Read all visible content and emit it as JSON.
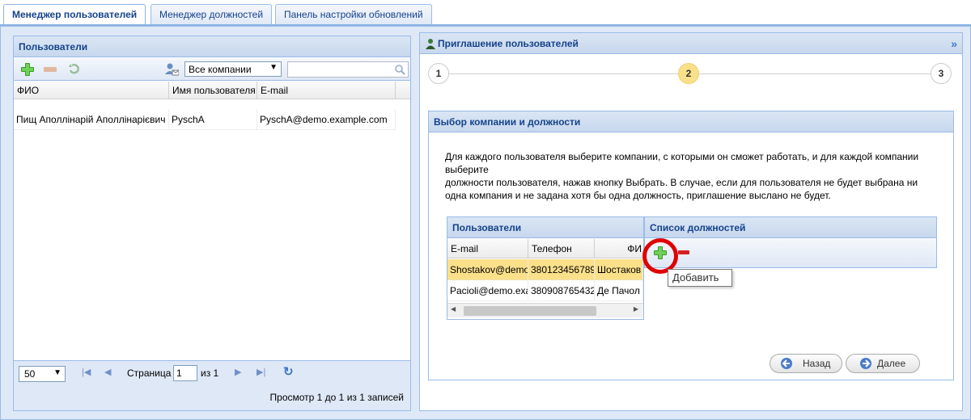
{
  "tabs": [
    {
      "label": "Менеджер пользователей"
    },
    {
      "label": "Менеджер должностей"
    },
    {
      "label": "Панель настройки обновлений"
    }
  ],
  "users_panel": {
    "title": "Пользователи",
    "company_filter": "Все компании",
    "search_placeholder": "",
    "columns": [
      "ФИО",
      "Имя пользователя",
      "E-mail"
    ],
    "rows": [
      {
        "name": "Пищ Аполлінарій Аполлінарієвич",
        "username": "PyschA",
        "email": "PyschA@demo.example.com"
      }
    ],
    "pager": {
      "page_size": "50",
      "page_label": "Страница",
      "page_value": "1",
      "of_label": "из 1",
      "summary": "Просмотр 1 до 1 из 1 записей"
    }
  },
  "invite_panel": {
    "title": "Приглашение пользователей",
    "steps": [
      "1",
      "2",
      "3"
    ],
    "section_title": "Выбор компании и должности",
    "description_lines": [
      "Для каждого пользователя выберите компании, с которыми он сможет работать, и для каждой компании",
      "выберите",
      "должности пользователя, нажав кнопку Выбрать. В случае, если для пользователя не будет выбрана ни",
      "одна компания и не задана хотя бы одна должность, приглашение выслано не будет."
    ],
    "sub_users": {
      "title": "Пользователи",
      "columns": [
        "E-mail",
        "Телефон",
        "ФИ"
      ],
      "rows": [
        {
          "email": "Shostakov@demo",
          "phone": "380123456789",
          "fio": "Шостаков"
        },
        {
          "email": "Pacioli@demo.exa",
          "phone": "380908765432",
          "fio": "Де Пачол"
        }
      ]
    },
    "positions": {
      "title": "Список должностей",
      "tooltip": "Добавить"
    },
    "back_label": "Назад",
    "next_label": "Далее"
  },
  "colors": {
    "accent": "#15428b",
    "frame": "#dfe8f6",
    "selected_row": "#fbe08a",
    "highlight_ring": "#e00000"
  }
}
